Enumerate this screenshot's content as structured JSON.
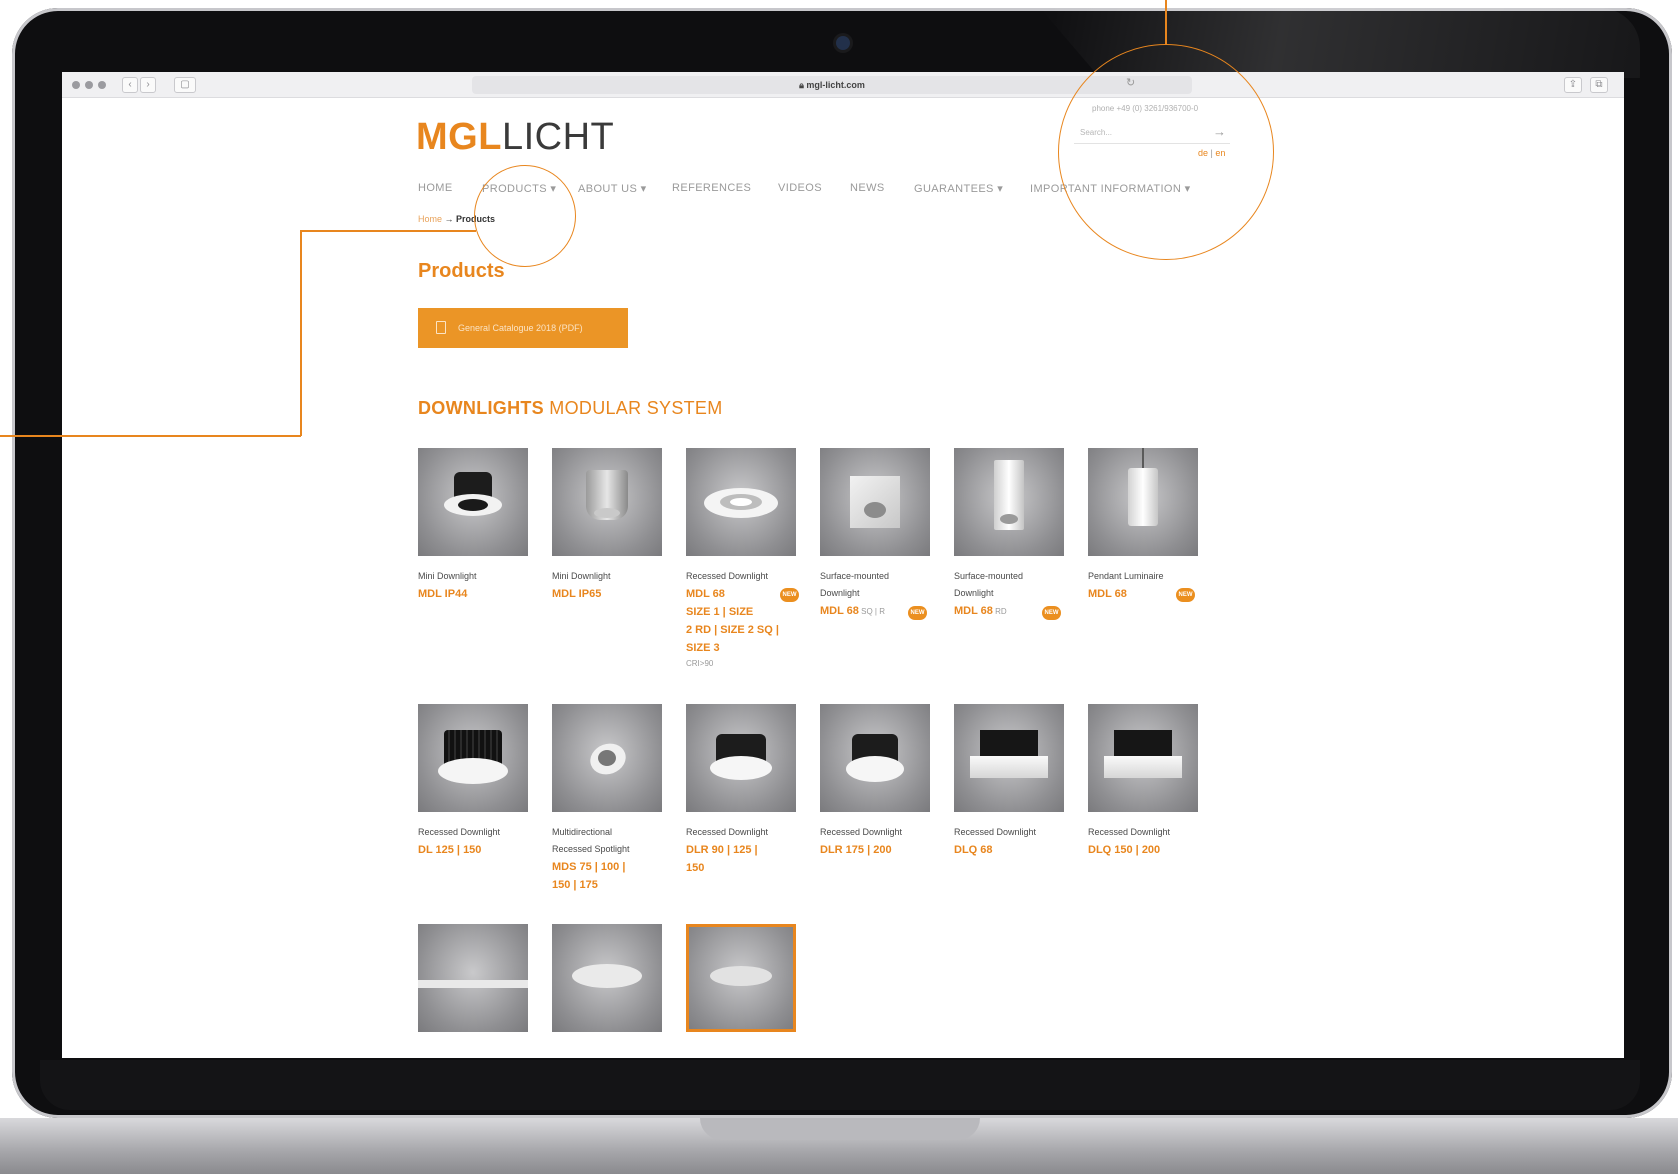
{
  "browser": {
    "url": "mgl-licht.com",
    "back_label": "‹",
    "forward_label": "›",
    "sidebar_label": "▢",
    "reload_icon": "reload-icon",
    "share_icon": "share-icon",
    "tabs_icon": "tabs-icon"
  },
  "header": {
    "logo_mgl": "MGL",
    "logo_licht": "LICHT",
    "phone": "phone +49 (0) 3261/936700-0",
    "search_placeholder": "Search...",
    "lang_de": "de",
    "lang_sep": "|",
    "lang_en": "en"
  },
  "nav": [
    {
      "label": "HOME"
    },
    {
      "label": "PRODUCTS ▾"
    },
    {
      "label": "ABOUT US ▾"
    },
    {
      "label": "REFERENCES"
    },
    {
      "label": "VIDEOS"
    },
    {
      "label": "NEWS"
    },
    {
      "label": "GUARANTEES ▾"
    },
    {
      "label": "IMPORTANT INFORMATION ▾"
    }
  ],
  "breadcrumb": {
    "home": "Home",
    "separator": "→",
    "current": "Products"
  },
  "page_title": "Products",
  "catalogue_button": "General Catalogue 2018 (PDF)",
  "section": {
    "strong": "DOWNLIGHTS",
    "rest": " MODULAR SYSTEM"
  },
  "badge_label": "NEW",
  "products_row1": [
    {
      "desc": "Mini Downlight",
      "model": "MDL IP44"
    },
    {
      "desc": "Mini Downlight",
      "model": "MDL IP65"
    },
    {
      "desc": "Recessed Downlight",
      "model_lines": [
        "MDL 68",
        "SIZE 1 | SIZE",
        "2 RD | SIZE 2 SQ |",
        "SIZE 3"
      ],
      "cri": "CRI>90"
    },
    {
      "desc": "Surface-mounted",
      "desc2": "Downlight",
      "model": "MDL 68",
      "sub": " SQ | R"
    },
    {
      "desc": "Surface-mounted",
      "desc2": "Downlight",
      "model": "MDL 68",
      "sub": " RD"
    },
    {
      "desc": "Pendant Luminaire",
      "model": "MDL 68"
    }
  ],
  "products_row2": [
    {
      "desc": "Recessed Downlight",
      "model": "DL 125 | 150"
    },
    {
      "desc": "Multidirectional",
      "desc2": "Recessed Spotlight",
      "model_lines": [
        "MDS 75 | 100 |",
        "150 | 175"
      ]
    },
    {
      "desc": "Recessed Downlight",
      "model_lines": [
        "DLR 90 | 125 |",
        "150"
      ]
    },
    {
      "desc": "Recessed Downlight",
      "model": "DLR 175 | 200"
    },
    {
      "desc": "Recessed Downlight",
      "model": "DLQ 68"
    },
    {
      "desc": "Recessed Downlight",
      "model": "DLQ 150 | 200"
    }
  ],
  "colors": {
    "accent": "#e8861e",
    "button": "#eb9526",
    "bezel": "#0e0e10"
  }
}
